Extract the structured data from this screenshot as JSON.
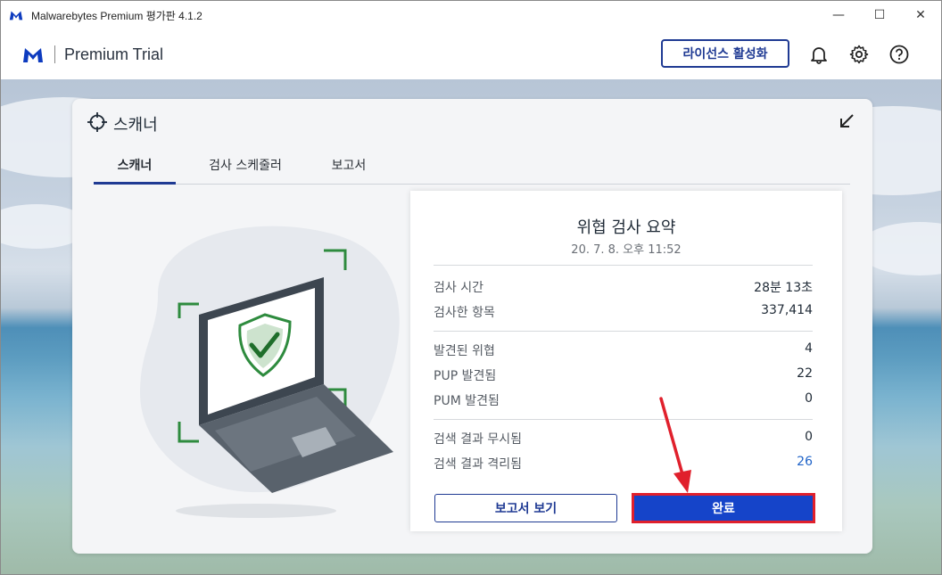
{
  "window": {
    "title": "Malwarebytes Premium 평가판  4.1.2",
    "controls": {
      "minimize": "—",
      "maximize": "☐",
      "close": "✕"
    }
  },
  "header": {
    "product": "Premium Trial",
    "license_button": "라이선스 활성화",
    "icons": [
      "bell-icon",
      "gear-icon",
      "help-icon"
    ]
  },
  "scanner": {
    "title": "스캐너",
    "tabs": [
      {
        "label": "스캐너",
        "active": true
      },
      {
        "label": "검사 스케줄러",
        "active": false
      },
      {
        "label": "보고서",
        "active": false
      }
    ]
  },
  "summary": {
    "title": "위협 검사 요약",
    "date": "20. 7. 8. 오후 11:52",
    "group1": [
      {
        "label": "검사 시간",
        "value": "28분 13초"
      },
      {
        "label": "검사한 항목",
        "value": "337,414"
      }
    ],
    "group2": [
      {
        "label": "발견된 위협",
        "value": "4"
      },
      {
        "label": "PUP 발견됨",
        "value": "22"
      },
      {
        "label": "PUM 발견됨",
        "value": "0"
      }
    ],
    "group3": [
      {
        "label": "검색 결과 무시됨",
        "value": "0"
      },
      {
        "label": "검색 결과 격리됨",
        "value": "26"
      }
    ],
    "view_report_button": "보고서 보기",
    "done_button": "완료"
  },
  "colors": {
    "brand_blue": "#1f3a93",
    "done_button": "#1544c9",
    "highlight_red": "#e0202c",
    "link_blue": "#1f63c8",
    "shield_green": "#2e8b3e"
  }
}
